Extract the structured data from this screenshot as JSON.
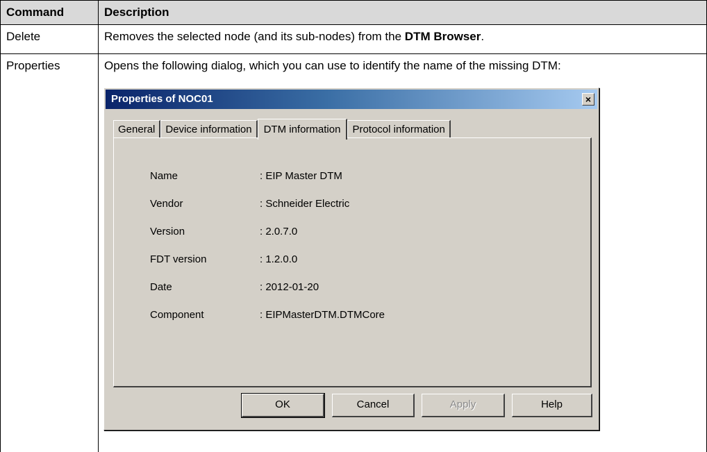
{
  "table": {
    "headers": [
      "Command",
      "Description"
    ],
    "rows": [
      {
        "command": "Delete",
        "description_prefix": "Removes the selected node (and its sub-nodes) from the ",
        "description_bold": "DTM Browser",
        "description_suffix": "."
      },
      {
        "command": "Properties",
        "description": "Opens the following dialog, which you can use to identify the name of the missing DTM:"
      }
    ]
  },
  "dialog": {
    "title": "Properties of NOC01",
    "close_label": "×",
    "tabs": [
      "General",
      "Device information",
      "DTM information",
      "Protocol information"
    ],
    "active_tab": "DTM information",
    "fields": [
      {
        "label": "Name",
        "value": ": EIP Master DTM"
      },
      {
        "label": "Vendor",
        "value": ": Schneider Electric"
      },
      {
        "label": "Version",
        "value": ": 2.0.7.0"
      },
      {
        "label": "FDT version",
        "value": ": 1.2.0.0"
      },
      {
        "label": "Date",
        "value": ": 2012-01-20"
      },
      {
        "label": "Component",
        "value": ": EIPMasterDTM.DTMCore"
      }
    ],
    "buttons": {
      "ok": "OK",
      "cancel": "Cancel",
      "apply": "Apply",
      "help": "Help"
    },
    "colors": {
      "face": "#d4d0c8",
      "title_start": "#0a246a",
      "title_end": "#a6caf0"
    }
  }
}
